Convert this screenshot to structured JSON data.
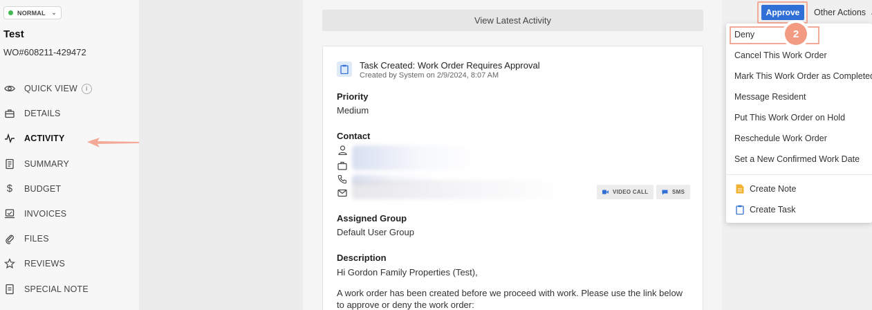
{
  "sidebar": {
    "status": "NORMAL",
    "title": "Test",
    "wo_number": "WO#608211-429472",
    "items": [
      {
        "label": "QUICK VIEW"
      },
      {
        "label": "DETAILS"
      },
      {
        "label": "ACTIVITY"
      },
      {
        "label": "SUMMARY"
      },
      {
        "label": "BUDGET"
      },
      {
        "label": "INVOICES"
      },
      {
        "label": "FILES"
      },
      {
        "label": "REVIEWS"
      },
      {
        "label": "SPECIAL NOTE"
      }
    ],
    "status_color": "#3fb950"
  },
  "center": {
    "view_latest": "View Latest Activity",
    "task_title": "Task Created: Work Order Requires Approval",
    "task_sub": "Created by System on 2/9/2024, 8:07 AM",
    "priority_label": "Priority",
    "priority_value": "Medium",
    "contact_label": "Contact",
    "video_call": "VIDEO CALL",
    "sms": "SMS",
    "group_label": "Assigned Group",
    "group_value": "Default User Group",
    "desc_label": "Description",
    "desc_greeting": "Hi Gordon Family Properties (Test),",
    "desc_body": "A work order has been created before we proceed with work. Please use the link below to approve or deny the work order:"
  },
  "actions": {
    "approve": "Approve",
    "other_actions": "Other Actions",
    "menu": [
      "Deny",
      "Cancel This Work Order",
      "Mark This Work Order as Completed",
      "Message Resident",
      "Put This Work Order on Hold",
      "Reschedule Work Order",
      "Set a New Confirmed Work Date"
    ],
    "create_note": "Create Note",
    "create_task": "Create Task",
    "step": "2",
    "accent": "#2f6fd6",
    "highlight": "#f4a998"
  }
}
